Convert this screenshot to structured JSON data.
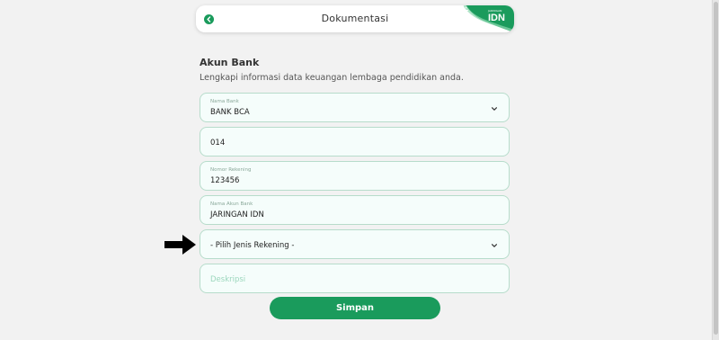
{
  "header": {
    "title": "Dokumentasi",
    "back_icon": "arrow-left-icon",
    "logo": {
      "top_text": "JARINGAN",
      "main_text": "IDN",
      "icon": "sun-icon"
    },
    "accent_color": "#1a9b5c"
  },
  "section": {
    "title": "Akun Bank",
    "description": "Lengkapi informasi data keuangan lembaga pendidikan anda."
  },
  "form": {
    "bank_name": {
      "label": "Nama Bank",
      "value": "BANK BCA"
    },
    "bank_code": {
      "value": "014"
    },
    "account_number": {
      "label": "Nomor Rekening",
      "value": "123456"
    },
    "account_name": {
      "label": "Nama Akun Bank",
      "value": "JARINGAN IDN"
    },
    "account_type": {
      "value": "- Pilih Jenis Rekening -"
    },
    "description": {
      "placeholder": "Deskripsi"
    },
    "submit_label": "Simpan"
  }
}
